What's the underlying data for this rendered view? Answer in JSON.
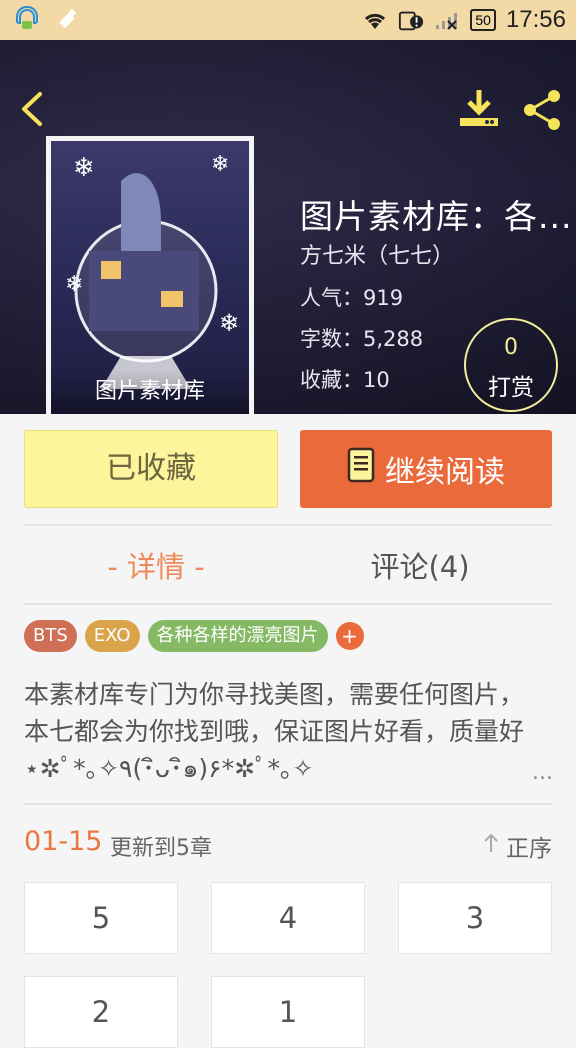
{
  "status_bar": {
    "time": "17:56",
    "battery": "50"
  },
  "header": {
    "book_title": "图片素材库：各...",
    "cover_title": "图片素材库",
    "author": "方七米（七七）",
    "stats": [
      "人气：919",
      "字数：5,288",
      "收藏：10"
    ],
    "reward": {
      "count": "0",
      "label": "打赏"
    }
  },
  "actions": {
    "collect_label": "已收藏",
    "read_label": "继续阅读"
  },
  "tabs": {
    "detail": "- 详情 -",
    "comment": "评论(4)"
  },
  "tags": [
    "BTS",
    "EXO",
    "各种各样的漂亮图片"
  ],
  "tag_add": "+",
  "description": "本素材库专门为你寻找美图，需要任何图片，本七都会为你找到哦，保证图片好看，质量好⋆✲ﾟ*｡✧٩(･ิᴗ･ิ๑)۶*✲ﾟ*｡✧",
  "more": "...",
  "chapters": {
    "range": "01-15",
    "update": "更新到5章",
    "sort": "正序",
    "items": [
      "5",
      "4",
      "3",
      "2",
      "1"
    ]
  },
  "colors": {
    "accent": "#ea6a3c",
    "collect_bg": "#fdf59b",
    "status_bar": "#f3d9a6"
  }
}
